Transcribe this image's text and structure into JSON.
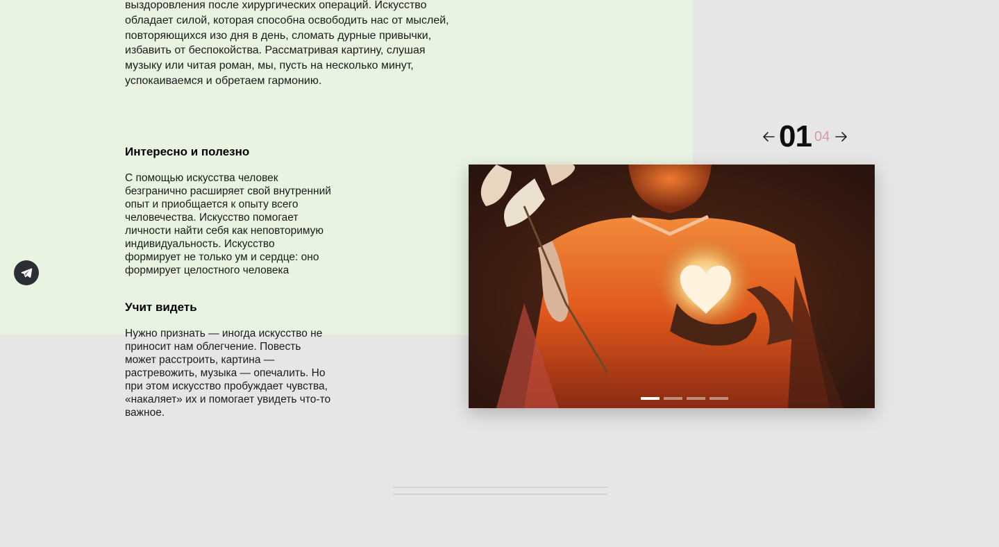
{
  "intro": {
    "text": "выздоровления после хирургических операций. Искусство обладает силой, которая способна освободить нас от мыслей, повторяющихся изо дня в день, сломать дурные привычки, избавить от беспокойства. Рассматривая картину, слушая музыку или читая роман, мы, пусть на несколько минут, успокаиваемся и обретаем гармонию."
  },
  "sections": [
    {
      "heading": "Интересно и полезно",
      "text": "С помощью искусства человек безгранично расширяет свой внутренний опыт и приобщается к опыту всего человечества. Искусство помогает личности найти себя как неповторимую индивидуальность. Искусство формирует не только ум и сердце: оно формирует целостного человека"
    },
    {
      "heading": "Учит видеть",
      "text": "Нужно признать — иногда искусство не приносит нам облегчение. Повесть может расстроить, картина — растревожить, музыка — опечалить. Но при этом искусство пробуждает чувства, «накаляет» их и помогает увидеть что-то важное."
    }
  ],
  "slider": {
    "current": "01",
    "total": "04",
    "prev_icon": "arrow-left-icon",
    "next_icon": "arrow-right-icon",
    "slide_count": 4,
    "active_slide": 1
  },
  "social": {
    "icon": "telegram-icon"
  },
  "colors": {
    "green_panel": "#e9f3e2",
    "background": "#e6e6e6",
    "counter_total": "#d99aa0",
    "telegram_bg": "#2b2e33"
  }
}
